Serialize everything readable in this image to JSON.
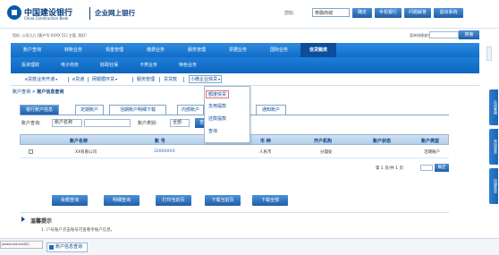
{
  "header": {
    "bank_name": "中国建设银行",
    "bank_name_en": "China Construction Bank",
    "site_title": "企业网上银行",
    "welcome_label": "您好,",
    "company_select": "恭融商城",
    "buttons": [
      "确定",
      "手机银行",
      "问题解答",
      "退出系统"
    ]
  },
  "infobar": {
    "user_info": "您好, 公司九九 [客户号:XXXX 51] 主管, 您好!",
    "menu_search_label": "菜单快捷查找:",
    "menu_search_button": "搜索"
  },
  "nav1": [
    "账户查询",
    "转账业务",
    "现金管理",
    "缴费业务",
    "服务管理",
    "票据业务",
    "国际业务",
    "信贷融资"
  ],
  "nav1_active_index": 7,
  "nav2": [
    "投资理财",
    "电子商务",
    "财政社保",
    "卡类业务",
    "特色业务"
  ],
  "nav3": {
    "items": [
      "e贷款业务开通",
      "e贷通",
      "网银循环贷",
      "服务管理",
      "贷贷款",
      "小微企业快贷"
    ],
    "active_index": 5
  },
  "dropdown": {
    "items": [
      "额度快贷",
      "支用提款",
      "还款提款",
      "查询"
    ],
    "highlight_index": 0
  },
  "breadcrumb": {
    "prefix": "账户查询",
    "sep": ">",
    "current": "账户信息查询"
  },
  "tabs": [
    "银行账户信息",
    "定期账户",
    "活期账户明细下载",
    "内部账户",
    "通知账户"
  ],
  "active_tab_index": 0,
  "filter": {
    "account_label": "账户查询:",
    "account_select": "账户名称",
    "type_label": "账户类别:",
    "type_select": "全部",
    "query_button": "查询"
  },
  "table": {
    "headers": [
      "账户名称",
      "账 号",
      "币 种",
      "开户机构",
      "账户状态",
      "账户类型"
    ],
    "rows": [
      [
        "XX有限公司",
        "3200XXXX",
        "人民币",
        "分理处",
        "",
        "活期账户"
      ]
    ]
  },
  "pager": {
    "text": "第 1 页/共 1 页",
    "go_button": "确定"
  },
  "actions": [
    "余额查询",
    "明细查询",
    "打印当前页",
    "下载当前页",
    "下载全部"
  ],
  "tips": {
    "title": "温馨提示",
    "line": "1. 户号账户点击账号可查看手账户信息。"
  },
  "statusbar": {
    "url": "javascript:void(0)",
    "task_label": "账户信息查询"
  },
  "side_tabs": [
    "在线客服",
    "常用菜单",
    "快捷菜单"
  ],
  "colors": {
    "primary": "#1a6fc9",
    "nav_dark": "#0c4d9c",
    "link": "#0a4a8f",
    "highlight_border": "#e07070"
  }
}
